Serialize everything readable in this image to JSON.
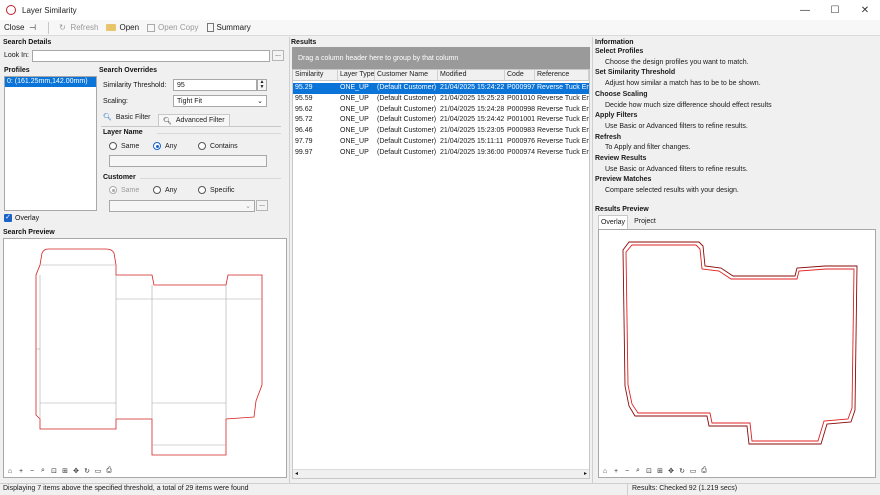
{
  "window": {
    "title": "Layer Similarity",
    "controls": [
      "—",
      "☐",
      "✕"
    ]
  },
  "toolbar": {
    "close": "Close",
    "refresh": "Refresh",
    "open": "Open",
    "open_copy": "Open Copy",
    "summary": "Summary"
  },
  "search_details": {
    "header": "Search Details",
    "look_in_label": "Look In:",
    "look_in_value": "",
    "profiles_header": "Profiles",
    "profiles": [
      "0: (161.25mm,142.00mm)"
    ],
    "overlay_label": "Overlay",
    "overlay_checked": true
  },
  "search_overrides": {
    "header": "Search Overrides",
    "threshold_label": "Similarity Threshold:",
    "threshold_value": "95",
    "scaling_label": "Scaling:",
    "scaling_value": "Tight Fit",
    "tab_basic": "Basic Filter",
    "tab_advanced": "Advanced Filter",
    "layer_name_header": "Layer Name",
    "layer_options": [
      "Same",
      "Any",
      "Contains"
    ],
    "layer_selected": "Any",
    "customer_header": "Customer",
    "customer_options": [
      "Same",
      "Any",
      "Specific"
    ],
    "customer_selected": "Same"
  },
  "search_preview": {
    "header": "Search Preview"
  },
  "results": {
    "header": "Results",
    "group_hint": "Drag a column header here to group by that column",
    "columns": [
      "Similarity",
      "Layer Type",
      "Customer Name",
      "Modified",
      "Code",
      "Reference"
    ],
    "rows": [
      [
        "95.29",
        "ONE_UP",
        "(Default Customer)",
        "21/04/2025 15:24:22",
        "P000997",
        "Reverse Tuck End"
      ],
      [
        "95.59",
        "ONE_UP",
        "(Default Customer)",
        "21/04/2025 15:25:23",
        "P001010",
        "Reverse Tuck End"
      ],
      [
        "95.62",
        "ONE_UP",
        "(Default Customer)",
        "21/04/2025 15:24:28",
        "P000998",
        "Reverse Tuck End"
      ],
      [
        "95.72",
        "ONE_UP",
        "(Default Customer)",
        "21/04/2025 15:24:42",
        "P001001",
        "Reverse Tuck End"
      ],
      [
        "96.46",
        "ONE_UP",
        "(Default Customer)",
        "21/04/2025 15:23:05",
        "P000983",
        "Reverse Tuck End"
      ],
      [
        "97.79",
        "ONE_UP",
        "(Default Customer)",
        "21/04/2025 15:11:11",
        "P000976",
        "Reverse Tuck End"
      ],
      [
        "99.97",
        "ONE_UP",
        "(Default Customer)",
        "21/04/2025 19:36:00",
        "P000974",
        "Reverse Tuck End"
      ]
    ],
    "selected_row": 0
  },
  "information": {
    "header": "Information",
    "items": [
      {
        "title": "Select Profiles",
        "text": "Choose the design profiles you want to match."
      },
      {
        "title": "Set Similarity Threshold",
        "text": "Adjust how similar a match has to be to be shown."
      },
      {
        "title": "Choose Scaling",
        "text": "Decide how much size difference should effect results"
      },
      {
        "title": "Apply Filters",
        "text": "Use Basic or Advanced filters to refine results."
      },
      {
        "title": "Refresh",
        "text": "To Apply and filter changes."
      },
      {
        "title": "Review Results",
        "text": "Use Basic or Advanced filters to refine results."
      },
      {
        "title": "Preview Matches",
        "text": "Compare selected results with your design."
      }
    ]
  },
  "results_preview": {
    "header": "Results Preview",
    "tabs": [
      "Overlay",
      "Project"
    ],
    "active_tab": "Overlay"
  },
  "status": {
    "left": "Displaying 7 items above the specified threshold, a total of 29 items were found",
    "right": "Results: Checked 92 (1.219 secs)"
  },
  "colors": {
    "accent": "#0a74d8",
    "dieline": "#d42020",
    "brand": "#c0202a"
  }
}
